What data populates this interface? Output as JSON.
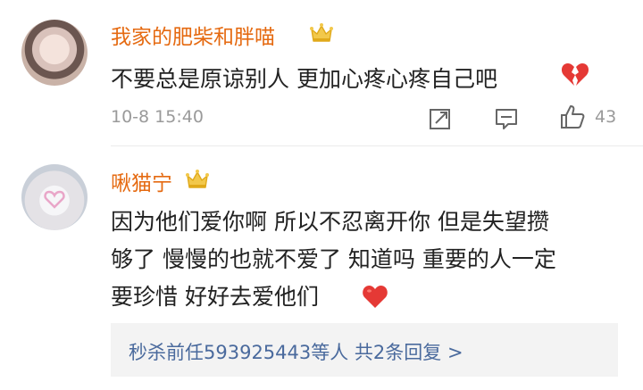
{
  "comments": [
    {
      "username": "我家的肥柴和胖喵",
      "text": "不要总是原谅别人 更加心疼心疼自己吧",
      "date": "10-8 15:40",
      "likes": "43",
      "badge_icon": "crown-icon",
      "emoji_icon": "broken-heart-icon"
    },
    {
      "username": "啾猫宁",
      "text_lines": [
        "因为他们爱你啊 所以不忍离开你 但是失望攒",
        "够了 慢慢的也就不爱了 知道吗 重要的人一定",
        "要珍惜 好好去爱他们"
      ],
      "badge_icon": "crown-icon",
      "emoji_icon": "red-heart-icon",
      "replies_link": "秒杀前任593925443等人  共2条回复 >"
    }
  ],
  "colors": {
    "username": "#e56a11",
    "body_text": "#222222",
    "meta_text": "#9a9a9a",
    "link": "#4a6a9d",
    "reply_bg": "#f3f3f3"
  }
}
